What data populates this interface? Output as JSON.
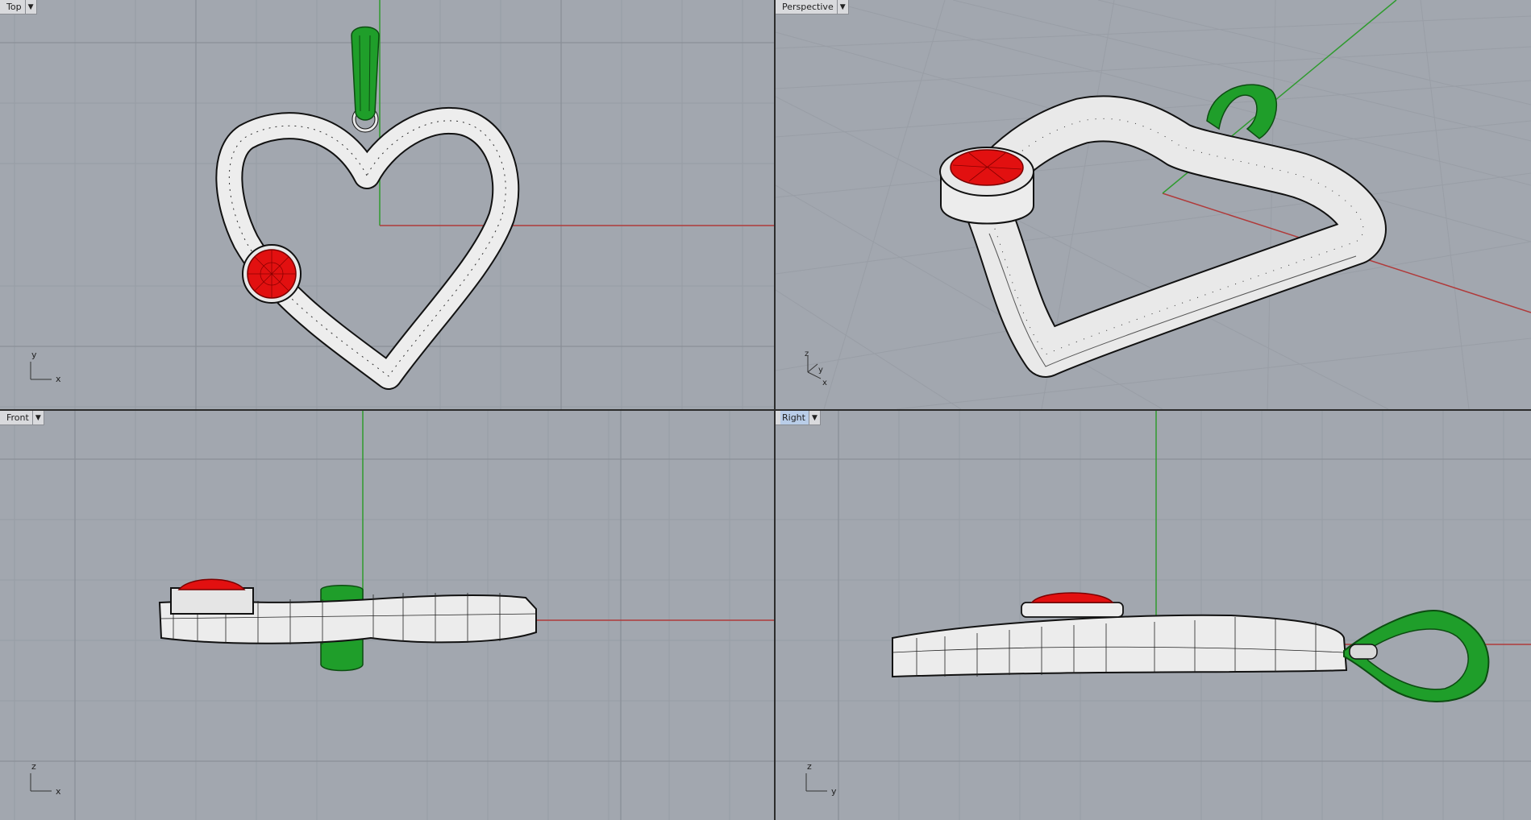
{
  "viewports": {
    "top": {
      "label": "Top",
      "axis_h": "x",
      "axis_v": "y"
    },
    "persp": {
      "label": "Perspective",
      "axis_1": "z",
      "axis_2": "y",
      "axis_3": "x"
    },
    "front": {
      "label": "Front",
      "axis_h": "x",
      "axis_v": "z"
    },
    "right": {
      "label": "Right",
      "axis_h": "y",
      "axis_v": "z"
    }
  },
  "icons": {
    "dropdown": "chevron-down-icon"
  },
  "colors": {
    "viewport_bg": "#a2a7af",
    "grid_minor": "#999ea6",
    "grid_major": "#8e939b",
    "x_axis": "#b03a3a",
    "y_axis": "#2f9b2f",
    "model_body": "#eeeeee",
    "model_wire": "#111111",
    "gem": "#e21010",
    "bail": "#1f9e2a",
    "active_tab": "#b9cde8"
  }
}
